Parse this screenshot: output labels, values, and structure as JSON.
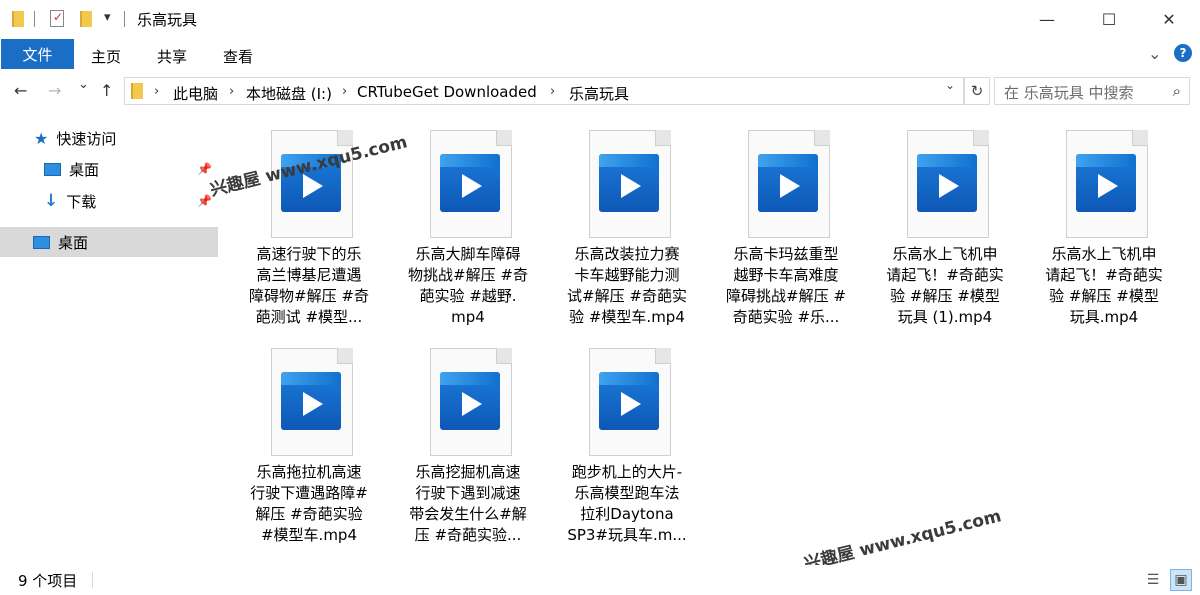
{
  "window": {
    "title": "乐高玩具",
    "minimize_glyph": "—",
    "maximize_glyph": "☐",
    "close_glyph": "✕",
    "quick_access_dropdown_glyph": "▾"
  },
  "ribbon": {
    "tabs": [
      "文件",
      "主页",
      "共享",
      "查看"
    ],
    "expand_glyph": "⌄",
    "help_glyph": "?"
  },
  "address": {
    "back_glyph": "←",
    "forward_glyph": "→",
    "recent_glyph": "⌄",
    "up_glyph": "↑",
    "breadcrumbs": [
      "此电脑",
      "本地磁盘 (I:)",
      "CRTubeGet Downloaded",
      "乐高玩具"
    ],
    "separator_glyph": "›",
    "dropdown_glyph": "⌄",
    "refresh_glyph": "↻",
    "search_placeholder": "在 乐高玩具 中搜索",
    "search_glyph": "⌕"
  },
  "sidebar": {
    "items": [
      {
        "label": "快速访问",
        "icon": "star-icon"
      },
      {
        "label": "桌面",
        "icon": "desktop-icon",
        "pinned": true
      },
      {
        "label": "下载",
        "icon": "download-icon",
        "pinned": true
      },
      {
        "label": "桌面",
        "icon": "desktop-icon",
        "selected": true
      }
    ],
    "pin_glyph": "📌"
  },
  "files": [
    {
      "lines": [
        "高速行驶下的乐",
        "高兰博基尼遭遇",
        "障碍物#解压 #奇",
        "葩测试 #模型..."
      ]
    },
    {
      "lines": [
        "乐高大脚车障碍",
        "物挑战#解压 #奇",
        "葩实验 #越野.",
        "mp4"
      ]
    },
    {
      "lines": [
        "乐高改装拉力赛",
        "卡车越野能力测",
        "试#解压 #奇葩实",
        "验 #模型车.mp4"
      ]
    },
    {
      "lines": [
        "乐高卡玛兹重型",
        "越野卡车高难度",
        "障碍挑战#解压 #",
        "奇葩实验 #乐..."
      ]
    },
    {
      "lines": [
        "乐高水上飞机申",
        "请起飞！#奇葩实",
        "验 #解压 #模型",
        "玩具 (1).mp4"
      ]
    },
    {
      "lines": [
        "乐高水上飞机申",
        "请起飞！#奇葩实",
        "验 #解压 #模型",
        "玩具.mp4"
      ]
    },
    {
      "lines": [
        "乐高拖拉机高速",
        "行驶下遭遇路障#",
        "解压 #奇葩实验",
        "#模型车.mp4"
      ]
    },
    {
      "lines": [
        "乐高挖掘机高速",
        "行驶下遇到减速",
        "带会发生什么#解",
        "压 #奇葩实验..."
      ]
    },
    {
      "lines": [
        "跑步机上的大片-",
        "乐高模型跑车法",
        "拉利Daytona",
        "SP3#玩具车.m..."
      ]
    }
  ],
  "watermarks": [
    "兴趣屋 www.xqu5.com",
    "兴趣屋 www.xqu5.com"
  ],
  "status": {
    "item_count": "9 个项目",
    "details_view_glyph": "☰",
    "large_icons_view_glyph": "▣"
  }
}
